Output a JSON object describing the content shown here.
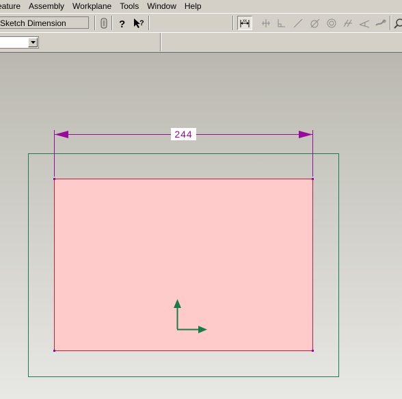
{
  "menu": {
    "items": [
      "eature",
      "Assembly",
      "Workplane",
      "Tools",
      "Window",
      "Help"
    ]
  },
  "toolbar": {
    "command_combo_value": "Sketch Dimension",
    "icons": [
      "sketch-dimension-icon",
      "constraint-icon",
      "perpendicular-icon",
      "line-icon",
      "tangent-icon",
      "concentric-icon",
      "parallel-icon",
      "angle-icon",
      "fix-icon",
      "zoom-icon"
    ]
  },
  "toolbar2": {
    "combo_value": ""
  },
  "sketch": {
    "dimension_value": "244",
    "colors": {
      "dimension": "#9a0a9a",
      "frame": "#1f7a52",
      "rectangle_fill": "#ffcaca",
      "rectangle_stroke": "#c01f3f",
      "axis": "#1a7a4a"
    }
  }
}
